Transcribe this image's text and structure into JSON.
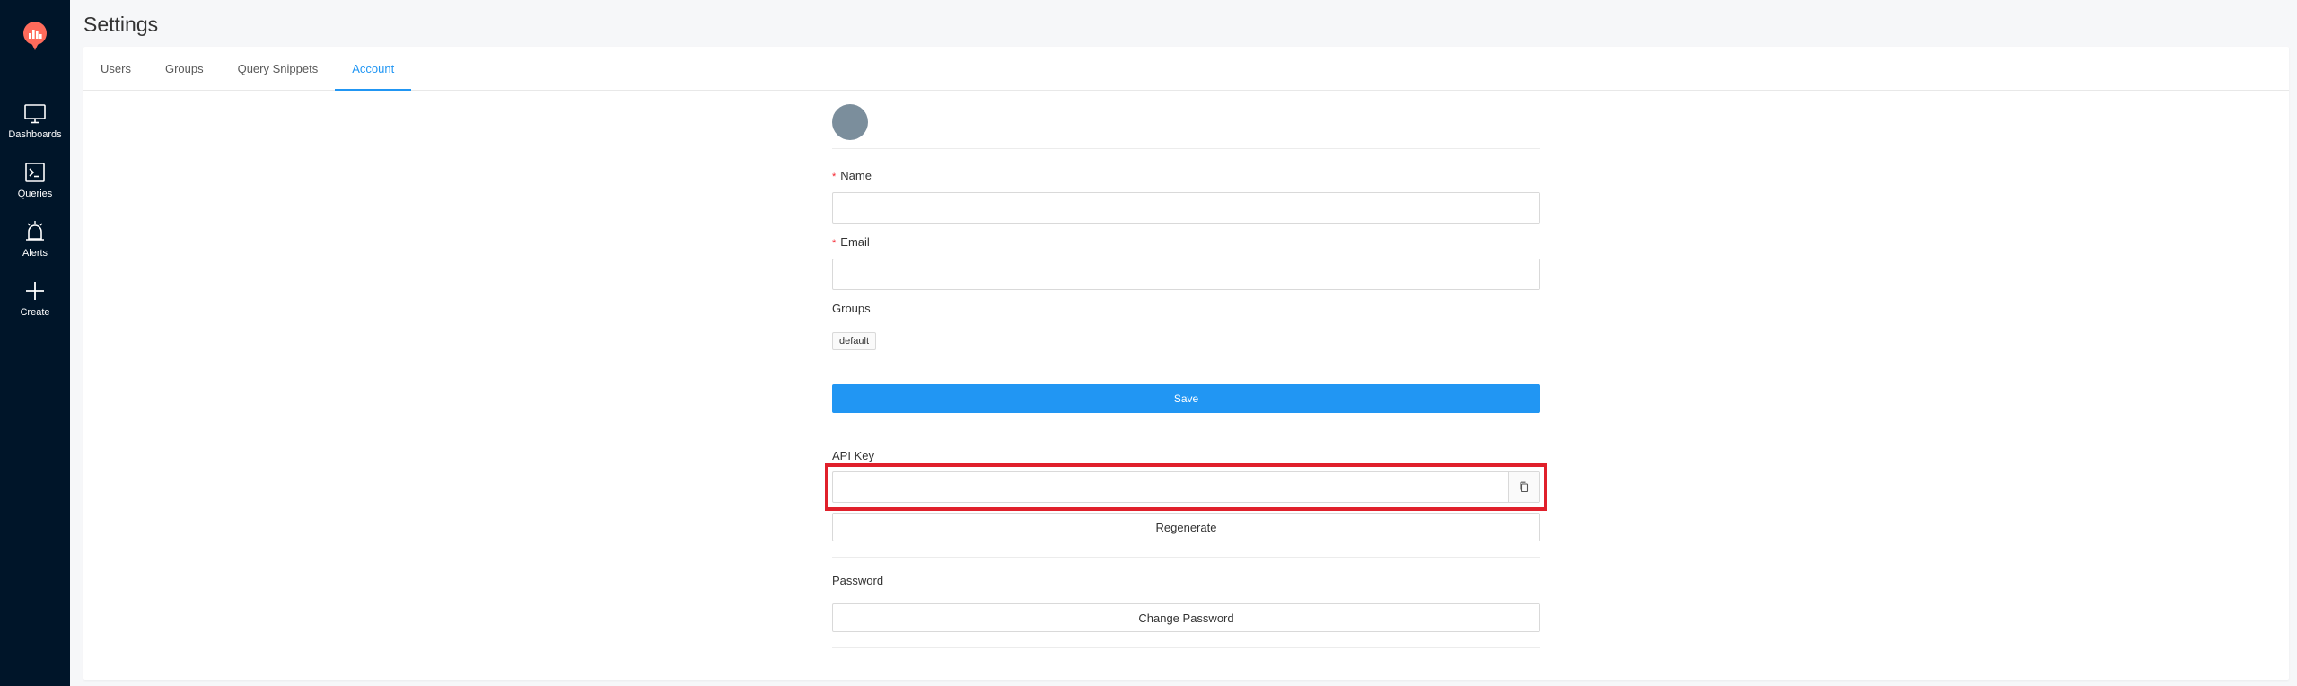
{
  "sidebar": {
    "logo_icon": "redash-logo-icon",
    "items": [
      {
        "label": "Dashboards",
        "icon": "monitor-icon"
      },
      {
        "label": "Queries",
        "icon": "terminal-icon"
      },
      {
        "label": "Alerts",
        "icon": "alarm-bell-icon"
      },
      {
        "label": "Create",
        "icon": "plus-icon"
      }
    ]
  },
  "page": {
    "title": "Settings"
  },
  "tabs": [
    {
      "label": "Users",
      "active": false
    },
    {
      "label": "Groups",
      "active": false
    },
    {
      "label": "Query Snippets",
      "active": false
    },
    {
      "label": "Account",
      "active": true
    }
  ],
  "account_form": {
    "name": {
      "label": "Name",
      "required_mark": "*",
      "value": ""
    },
    "email": {
      "label": "Email",
      "required_mark": "*",
      "value": ""
    },
    "groups": {
      "label": "Groups",
      "tags": [
        "default"
      ]
    },
    "save_label": "Save",
    "api_key": {
      "label": "API Key",
      "value": "",
      "copy_icon": "copy-icon"
    },
    "regenerate_label": "Regenerate",
    "password": {
      "label": "Password",
      "change_label": "Change Password"
    }
  },
  "colors": {
    "sidebar_bg": "#001529",
    "accent": "#2196f3",
    "highlight": "#e0202b",
    "logo": "#ff6b5b"
  }
}
